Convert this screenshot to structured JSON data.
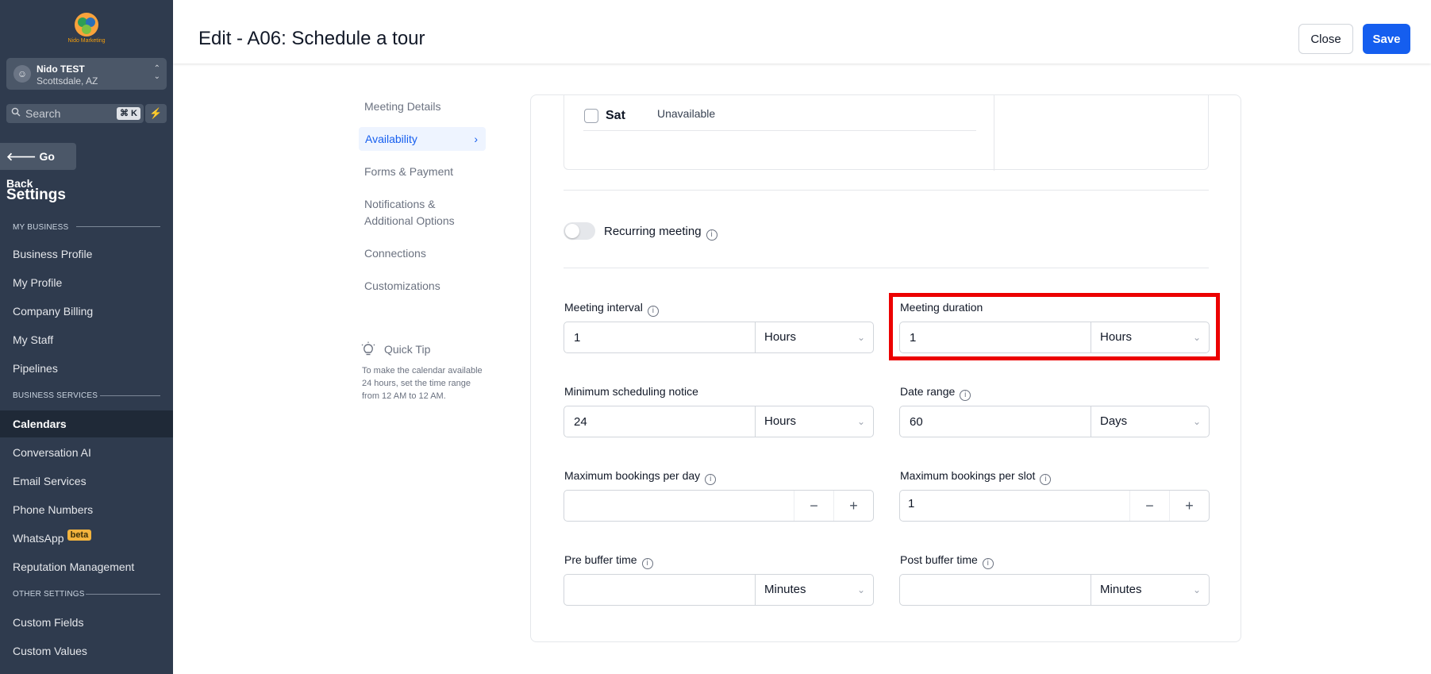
{
  "logo": {
    "text": "Nido Marketing"
  },
  "account": {
    "name": "Nido TEST",
    "location": "Scottsdale, AZ"
  },
  "search": {
    "placeholder": "Search",
    "shortcut": "⌘ K"
  },
  "go_back_label": "Go Back",
  "settings_title": "Settings",
  "sidebar": {
    "section_my_business": "MY BUSINESS",
    "section_business_services": "BUSINESS SERVICES",
    "section_other_settings": "OTHER SETTINGS",
    "items": [
      {
        "label": "Business Profile"
      },
      {
        "label": "My Profile"
      },
      {
        "label": "Company Billing"
      },
      {
        "label": "My Staff"
      },
      {
        "label": "Pipelines"
      },
      {
        "label": "Calendars"
      },
      {
        "label": "Conversation AI"
      },
      {
        "label": "Email Services"
      },
      {
        "label": "Phone Numbers"
      },
      {
        "label": "WhatsApp"
      },
      {
        "label": "Reputation Management"
      },
      {
        "label": "Custom Fields"
      },
      {
        "label": "Custom Values"
      }
    ],
    "active_item": "Calendars",
    "beta_badge": "beta"
  },
  "header": {
    "title": "Edit - A06: Schedule a tour",
    "close_label": "Close",
    "save_label": "Save"
  },
  "subnav": {
    "items": [
      {
        "label": "Meeting Details"
      },
      {
        "label": "Availability"
      },
      {
        "label": "Forms & Payment"
      },
      {
        "label": "Notifications & Additional Options"
      },
      {
        "label": "Connections"
      },
      {
        "label": "Customizations"
      }
    ],
    "active": "Availability"
  },
  "quick_tip": {
    "title": "Quick Tip",
    "body": "To make the calendar available 24 hours, set the time range from 12 AM to 12 AM."
  },
  "availability": {
    "day": {
      "label": "Sat",
      "status": "Unavailable",
      "checked": false
    },
    "recurring": {
      "label": "Recurring meeting",
      "enabled": false
    },
    "meeting_interval": {
      "label": "Meeting interval",
      "value": "1",
      "unit": "Hours"
    },
    "meeting_duration": {
      "label": "Meeting duration",
      "value": "1",
      "unit": "Hours"
    },
    "min_notice": {
      "label": "Minimum scheduling notice",
      "value": "24",
      "unit": "Hours"
    },
    "date_range": {
      "label": "Date range",
      "value": "60",
      "unit": "Days"
    },
    "max_per_day": {
      "label": "Maximum bookings per day",
      "value": ""
    },
    "max_per_slot": {
      "label": "Maximum bookings per slot",
      "value": "1"
    },
    "pre_buffer": {
      "label": "Pre buffer time",
      "value": "",
      "unit": "Minutes"
    },
    "post_buffer": {
      "label": "Post buffer time",
      "value": "",
      "unit": "Minutes"
    }
  },
  "colors": {
    "sidebar": "#2f3b4e",
    "primary": "#155eef",
    "highlight": "#ec0000"
  }
}
